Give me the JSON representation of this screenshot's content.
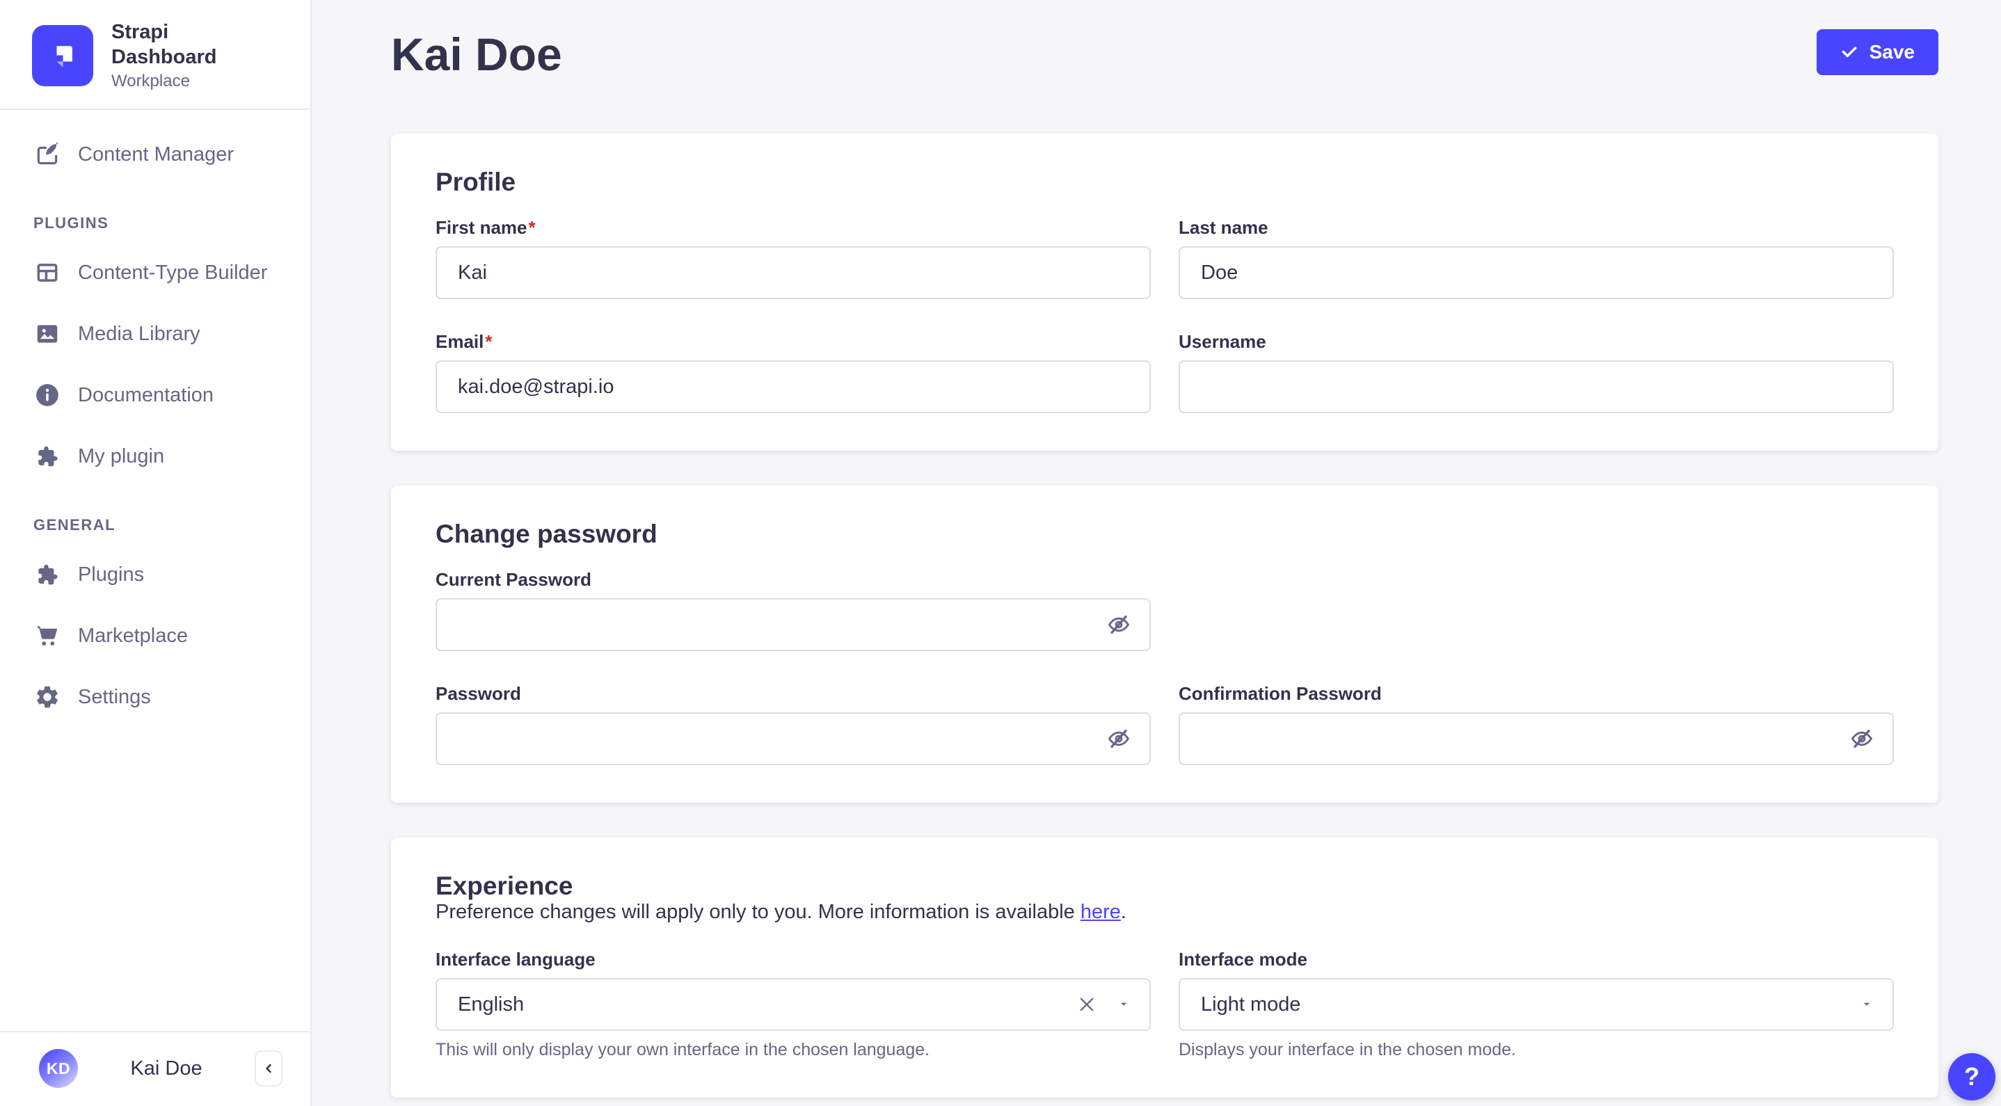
{
  "colors": {
    "primary": "#4945ff",
    "danger": "#d02b20",
    "text_dark": "#32324d",
    "text_muted": "#666687",
    "input_border": "#dcdce4",
    "divider": "#eaeaef",
    "main_background": "#f6f6f9"
  },
  "sidebar": {
    "brand": {
      "title": "Strapi Dashboard",
      "subtitle": "Workplace"
    },
    "nav": {
      "content_manager": "Content Manager",
      "plugins_header": "PLUGINS",
      "content_type_builder": "Content-Type Builder",
      "media_library": "Media Library",
      "documentation": "Documentation",
      "my_plugin": "My plugin",
      "general_header": "GENERAL",
      "plugins": "Plugins",
      "marketplace": "Marketplace",
      "settings": "Settings"
    },
    "user": {
      "initials": "KD",
      "name": "Kai Doe"
    }
  },
  "header": {
    "title": "Kai Doe",
    "save_label": "Save"
  },
  "profile": {
    "title": "Profile",
    "required_mark": "*",
    "first_name": {
      "label": "First name",
      "value": "Kai"
    },
    "last_name": {
      "label": "Last name",
      "value": "Doe"
    },
    "email": {
      "label": "Email",
      "value": "kai.doe@strapi.io"
    },
    "username": {
      "label": "Username",
      "value": ""
    }
  },
  "password": {
    "title": "Change password",
    "current": {
      "label": "Current Password",
      "value": ""
    },
    "new": {
      "label": "Password",
      "value": ""
    },
    "confirm": {
      "label": "Confirmation Password",
      "value": ""
    }
  },
  "experience": {
    "title": "Experience",
    "description_text": "Preference changes will apply only to you. More information is available ",
    "description_link": "here",
    "description_end": ".",
    "language": {
      "label": "Interface language",
      "value": "English",
      "helper": "This will only display your own interface in the chosen language."
    },
    "mode": {
      "label": "Interface mode",
      "value": "Light mode",
      "helper": "Displays your interface in the chosen mode."
    }
  },
  "help": {
    "label": "?"
  }
}
